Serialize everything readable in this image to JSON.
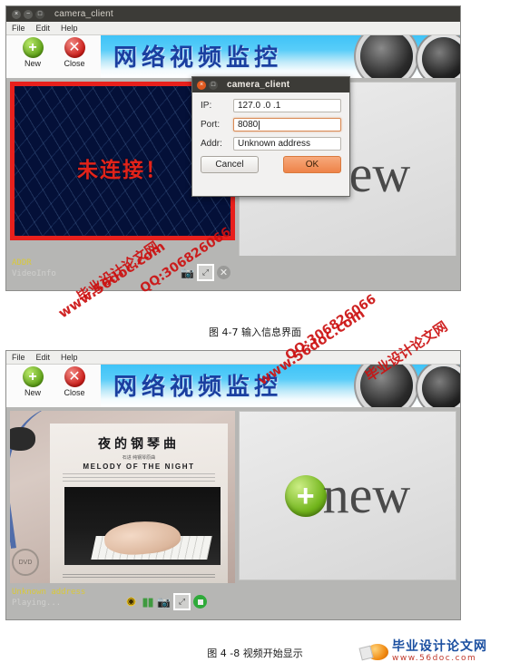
{
  "figure1": {
    "window": {
      "title": "camera_client",
      "controls": [
        "close",
        "minimize",
        "maximize"
      ],
      "menu": [
        "File",
        "Edit",
        "Help"
      ],
      "toolbar": [
        {
          "label": "New",
          "icon": "plus-circle-icon"
        },
        {
          "label": "Close",
          "icon": "close-circle-icon"
        }
      ],
      "banner_title": "网络视频监控",
      "video": {
        "overlay_text": "未连接！"
      },
      "new_pane": {
        "icon": "plus-circle-icon",
        "label": "new"
      },
      "status": {
        "addr": "ADDR",
        "info": "VideoInfo"
      },
      "status_icons": [
        "snapshot-icon",
        "fullscreen-icon",
        "close-icon"
      ]
    },
    "dialog": {
      "title": "camera_client",
      "fields": [
        {
          "label": "IP:",
          "value": "127.0 .0 .1",
          "focused": false
        },
        {
          "label": "Port:",
          "value": "8080",
          "focused": true
        },
        {
          "label": "Addr:",
          "value": "Unknown address",
          "focused": false
        }
      ],
      "cancel_label": "Cancel",
      "ok_label": "OK"
    },
    "caption": "图 4-7 输入信息界面"
  },
  "figure2": {
    "window": {
      "menu": [
        "File",
        "Edit",
        "Help"
      ],
      "toolbar": [
        {
          "label": "New",
          "icon": "plus-circle-icon"
        },
        {
          "label": "Close",
          "icon": "close-circle-icon"
        }
      ],
      "banner_title": "网络视频监控",
      "video": {
        "cd_title_cn": "夜的钢琴曲",
        "cd_author": "石进 纯钢琴原曲",
        "cd_title_en": "MELODY OF THE NIGHT"
      },
      "new_pane": {
        "icon": "plus-circle-icon",
        "label": "new"
      },
      "status": {
        "addr": "Unknown address",
        "info": "Playing..."
      },
      "status_icons": [
        "eye-icon",
        "pause-icon",
        "camera-icon",
        "fullscreen-icon",
        "stop-icon"
      ]
    },
    "caption": "图 4 -8 视频开始显示"
  },
  "watermarks": [
    {
      "text": "www.56doc.com"
    },
    {
      "text": "毕业设计论文网"
    },
    {
      "text": "QQ:306826066"
    }
  ],
  "logo": {
    "name_cn": "毕业设计论文网",
    "url": "www.56doc.com",
    "icon": "orange-ball-icon"
  },
  "colors": {
    "banner_blue": "#1a3fa0",
    "alert_red": "#e2231a",
    "ok_orange": "#ee8348",
    "status_yellow": "#d9c93a",
    "watermark_red": "#cc1111"
  }
}
